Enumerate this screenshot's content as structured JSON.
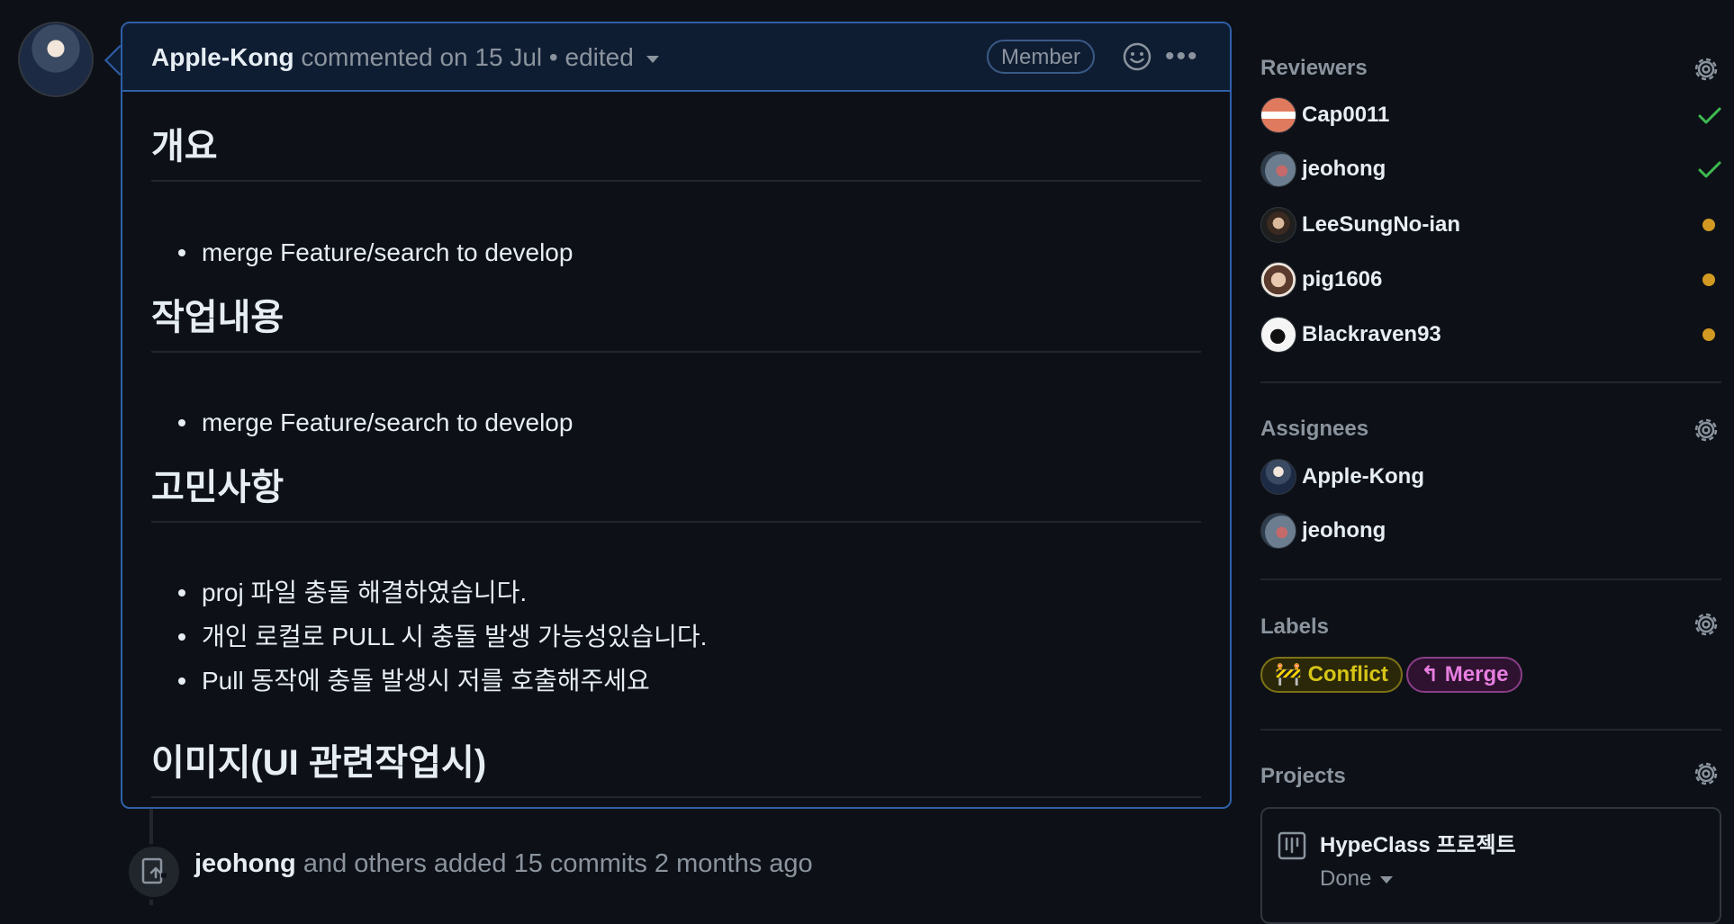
{
  "comment": {
    "author": "Apple-Kong",
    "meta": " commented on 15 Jul • edited",
    "badge": "Member",
    "sections": [
      {
        "heading": "개요",
        "items": [
          "merge Feature/search to develop"
        ]
      },
      {
        "heading": "작업내용",
        "items": [
          "merge Feature/search to develop"
        ]
      },
      {
        "heading": "고민사항",
        "items": [
          "proj 파일 충돌 해결하였습니다.",
          "개인 로컬로 PULL 시 충돌 발생 가능성있습니다.",
          "Pull 동작에 충돌 발생시 저를 호출해주세요"
        ]
      },
      {
        "heading": "이미지(UI 관련작업시)",
        "items": []
      }
    ]
  },
  "timeline": {
    "author": "jeohong",
    "text": " and others added 15 commits 2 months ago"
  },
  "sidebar": {
    "reviewers": {
      "title": "Reviewers",
      "items": [
        {
          "name": "Cap0011",
          "status": "approved"
        },
        {
          "name": "jeohong",
          "status": "approved"
        },
        {
          "name": "LeeSungNo-ian",
          "status": "pending"
        },
        {
          "name": "pig1606",
          "status": "pending"
        },
        {
          "name": "Blackraven93",
          "status": "pending"
        }
      ]
    },
    "assignees": {
      "title": "Assignees",
      "items": [
        {
          "name": "Apple-Kong"
        },
        {
          "name": "jeohong"
        }
      ]
    },
    "labels": {
      "title": "Labels",
      "items": [
        {
          "icon": "🚧",
          "text": "Conflict",
          "color": "#d6c418"
        },
        {
          "icon": "↰",
          "text": "Merge",
          "color": "#e77ee0"
        }
      ]
    },
    "projects": {
      "title": "Projects",
      "name": "HypeClass 프로젝트",
      "status": "Done"
    }
  },
  "colors": {
    "approved": "#3fb950",
    "pending": "#d29922",
    "accent_border": "#2f5fa8"
  }
}
